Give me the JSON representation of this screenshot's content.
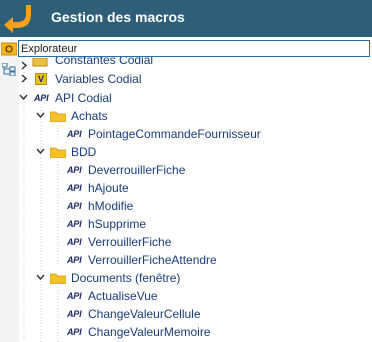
{
  "header": {
    "title": "Gestion des macros",
    "back_icon": "back-arrow-icon",
    "accent": "#f5a01a",
    "bg": "#2f5e78"
  },
  "explorer": {
    "label": "Explorateur"
  },
  "tree": {
    "constantes": {
      "label": "Constantes Codial"
    },
    "variables": {
      "label": "Variables Codial",
      "badge": "V"
    },
    "api": {
      "label": "API Codial",
      "badge": "API",
      "achats": {
        "label": "Achats",
        "items": [
          "PointageCommandeFournisseur"
        ]
      },
      "bdd": {
        "label": "BDD",
        "items": [
          "DeverrouillerFiche",
          "hAjoute",
          "hModifie",
          "hSupprime",
          "VerrouillerFiche",
          "VerrouillerFicheAttendre"
        ]
      },
      "documents": {
        "label": "Documents (fenêtre)",
        "items": [
          "ActualiseVue",
          "ChangeValeurCellule",
          "ChangeValeurMemoire"
        ]
      }
    }
  }
}
